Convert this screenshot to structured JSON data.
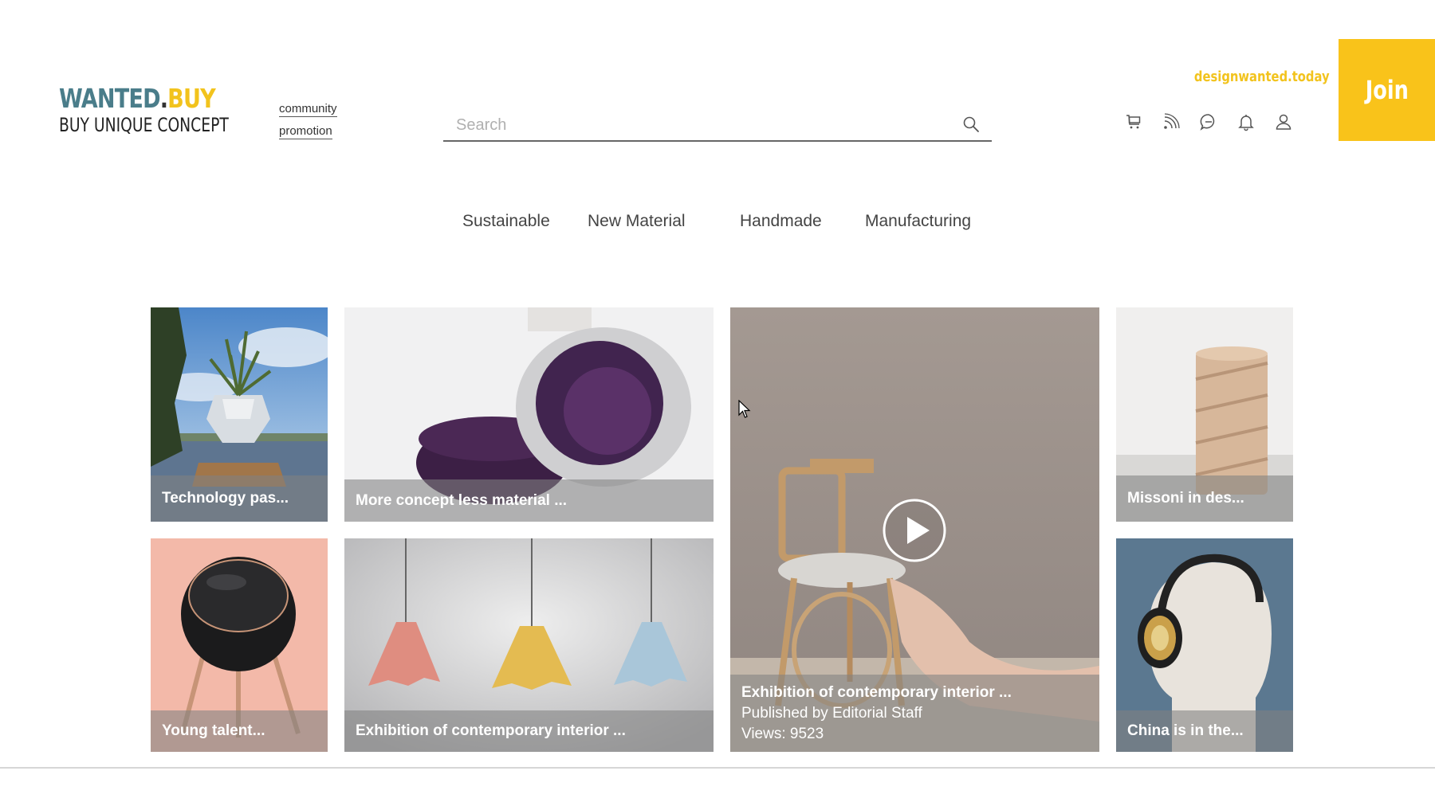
{
  "logo": {
    "part1": "WANTED",
    "dot": ".",
    "part2": "BUY",
    "tagline": "BUY UNIQUE CONCEPT"
  },
  "header": {
    "community_link": "community",
    "promotion_link": "promotion",
    "site_link": "designwanted.today",
    "join_label": "Join",
    "icons": [
      "cart-icon",
      "rss-icon",
      "chat-icon",
      "bell-icon",
      "user-icon"
    ]
  },
  "search": {
    "placeholder": "Search",
    "value": ""
  },
  "categories": [
    "Sustainable",
    "New Material",
    "Handmade",
    "Manufacturing"
  ],
  "tiles": [
    {
      "caption": "Technology pas..."
    },
    {
      "caption": "More concept less material ..."
    },
    {
      "caption": "Exhibition of contemporary interior ...",
      "published": "Published by Editorial Staff",
      "views": "Views: 9523",
      "has_video": true
    },
    {
      "caption": "Missoni in des..."
    },
    {
      "caption": "Young talent..."
    },
    {
      "caption": "Exhibition of contemporary interior ..."
    },
    {
      "caption": "China is in the..."
    }
  ],
  "colors": {
    "accent": "#f9c31a",
    "logo_teal": "#4a7d8a",
    "caption_overlay": "rgba(130,130,130,0.58)"
  }
}
